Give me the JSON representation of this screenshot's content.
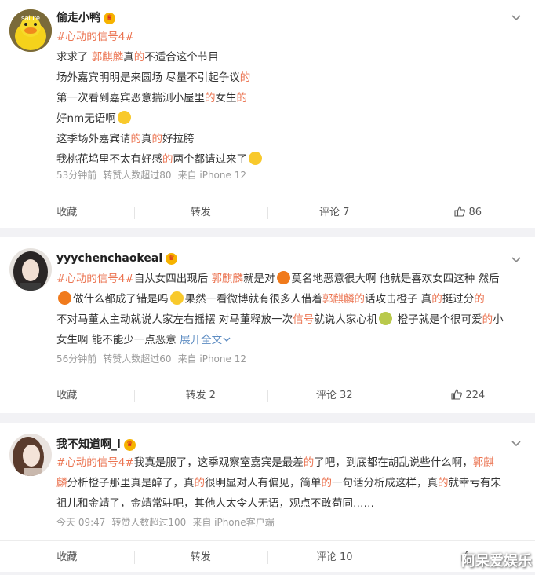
{
  "posts": [
    {
      "name": "偷走小鸭",
      "avatar_label": "salute",
      "tag": "#心动的信号4#",
      "meta": {
        "time": "53分钟前",
        "forwards": "转赞人数超过80",
        "source": "来自 iPhone 12"
      },
      "actions": {
        "collect": "收藏",
        "forward": "转发",
        "comment": "评论 7",
        "like": "86"
      }
    },
    {
      "name": "yyychenchaokeai",
      "tag": "#心动的信号4#",
      "expand": "展开全文",
      "meta": {
        "time": "56分钟前",
        "forwards": "转赞人数超过60",
        "source": "来自 iPhone 12"
      },
      "actions": {
        "collect": "收藏",
        "forward": "转发 2",
        "comment": "评论 32",
        "like": "224"
      }
    },
    {
      "name": "我不知道啊_l",
      "tag": "#心动的信号4#",
      "meta": {
        "time": "今天 09:47",
        "forwards": "转赞人数超过100",
        "source": "来自 iPhone客户端"
      },
      "actions": {
        "collect": "收藏",
        "forward": "转发",
        "comment": "评论 10",
        "like": ""
      }
    }
  ],
  "post1_lines": {
    "l1a": "求求了 ",
    "l1b": "郭麒麟",
    "l1c": "真",
    "l1d": "的",
    "l1e": "不适合这个节目",
    "l2a": "场外嘉宾明明是来圆场 尽量不引起争议",
    "l2b": "的",
    "l3a": "第一次看到嘉宾恶意揣测小屋里",
    "l3b": "的",
    "l3c": "女生",
    "l3d": "的",
    "l4": "好nm无语啊",
    "l5a": "这季场外嘉宾请",
    "l5b": "的",
    "l5c": "真",
    "l5d": "的",
    "l5e": "好拉胯",
    "l6a": "我桃花坞里不太有好感",
    "l6b": "的",
    "l6c": "两个都请过来了"
  },
  "post2_lines": {
    "a1": "自从女四出现后 ",
    "a2": "郭麒麟",
    "a3": "就是对",
    "a4": "莫名地恶意很大啊 他就是喜欢女四这种 然后",
    "b1": "做什么都成了错是吗",
    "b2": "果然一看微博就有很多人借着",
    "b3": "郭麒麟的",
    "b4": "话攻击橙子 真",
    "b5": "的",
    "b6": "挺过分",
    "b7": "的",
    "c1": "不对马董太主动就说人家左右摇摆 对马董释放一次",
    "c2": "信号",
    "c3": "就说人家心机",
    "c4": " 橙子就是个很可爱",
    "c5": "的",
    "c6": "小",
    "d1": "女生啊 能不能少一点恶意 "
  },
  "post3_lines": {
    "a1": "我真是服了，这季观察室嘉宾是最差",
    "a2": "的",
    "a3": "了吧，到底都在胡乱说些什么啊，",
    "a4": "郭麒",
    "b1": "麟",
    "b2": "分析橙子那里真是醉了，真",
    "b3": "的",
    "b4": "很明显对人有偏见，简单",
    "b5": "的",
    "b6": "一句话分析成这样，真",
    "b7": "的",
    "b8": "就幸亏有宋",
    "c1": "祖儿和金靖了，金靖常驻吧，其他人太令人无语，观点不敢苟同……"
  },
  "watermark": "阿呆爱娱乐",
  "colors": {
    "accent": "#eb7350",
    "link": "#5d8cc2",
    "meta": "#9a9a9a"
  }
}
